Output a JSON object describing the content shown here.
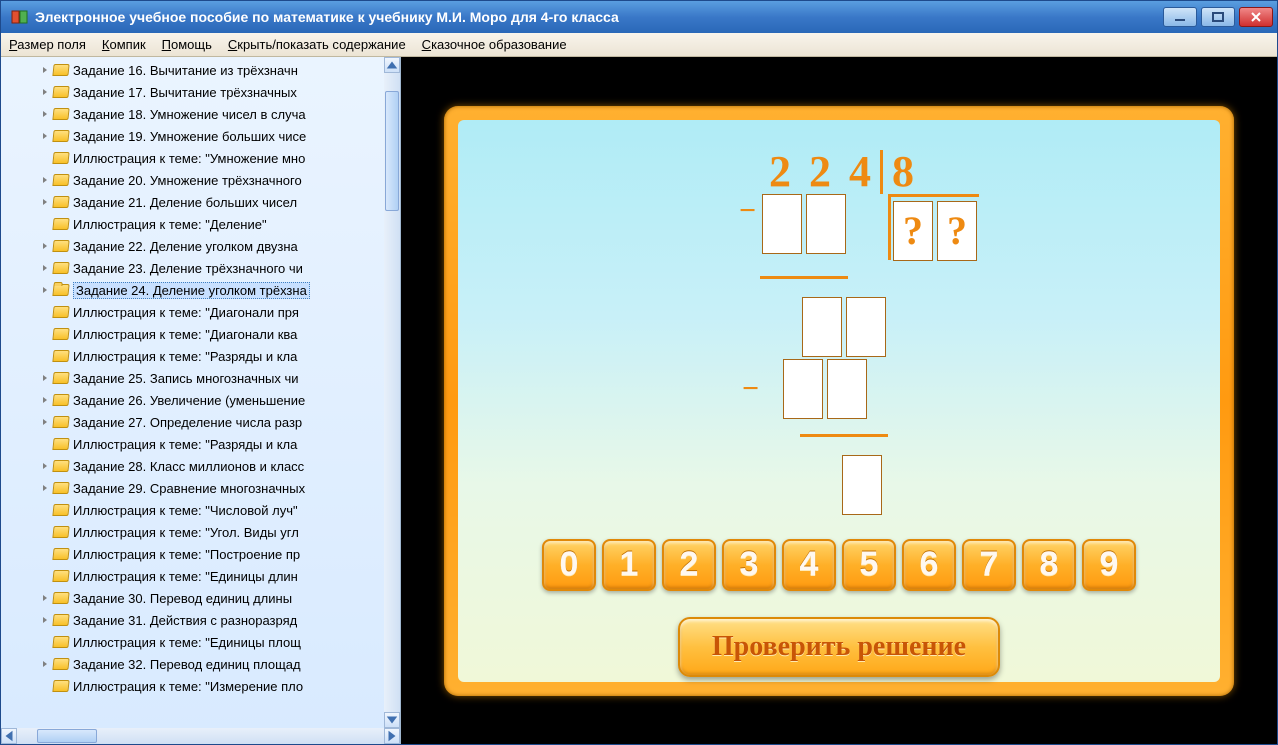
{
  "window": {
    "title": "Электронное учебное пособие по математике к учебнику М.И. Моро для 4-го класса"
  },
  "menu": {
    "items": [
      {
        "label": "Размер поля",
        "ul": "Р"
      },
      {
        "label": "Компик",
        "ul": "К"
      },
      {
        "label": "Помощь",
        "ul": "П"
      },
      {
        "label": "Скрыть/показать содержание",
        "ul": "С"
      },
      {
        "label": "Сказочное образование",
        "ul": "С"
      }
    ]
  },
  "tree": {
    "items": [
      {
        "label": "Задание 16. Вычитание из трёхзначн",
        "expandable": true
      },
      {
        "label": "Задание 17. Вычитание трёхзначных ",
        "expandable": true
      },
      {
        "label": "Задание 18. Умножение чисел в случа",
        "expandable": true
      },
      {
        "label": "Задание 19. Умножение больших чисе",
        "expandable": true
      },
      {
        "label": "Иллюстрация к теме: \"Умножение мно",
        "expandable": false
      },
      {
        "label": "Задание 20. Умножение трёхзначного",
        "expandable": true
      },
      {
        "label": "Задание 21. Деление больших чисел ",
        "expandable": true
      },
      {
        "label": "Иллюстрация к теме: \"Деление\"",
        "expandable": false
      },
      {
        "label": "Задание 22. Деление уголком двузна",
        "expandable": true
      },
      {
        "label": "Задание 23. Деление трёхзначного чи",
        "expandable": true
      },
      {
        "label": "Задание 24. Деление уголком трёхзна",
        "expandable": true,
        "selected": true,
        "open": true
      },
      {
        "label": "Иллюстрация к теме: \"Диагонали пря",
        "expandable": false
      },
      {
        "label": "Иллюстрация к теме: \"Диагонали ква",
        "expandable": false
      },
      {
        "label": "Иллюстрация к теме: \"Разряды и кла",
        "expandable": false
      },
      {
        "label": "Задание 25. Запись многозначных чи",
        "expandable": true
      },
      {
        "label": "Задание 26. Увеличение (уменьшение",
        "expandable": true
      },
      {
        "label": "Задание 27. Определение числа разр",
        "expandable": true
      },
      {
        "label": "Иллюстрация к теме: \"Разряды и кла",
        "expandable": false
      },
      {
        "label": "Задание 28. Класс миллионов и класс",
        "expandable": true
      },
      {
        "label": "Задание 29. Сравнение многозначных",
        "expandable": true
      },
      {
        "label": "Иллюстрация к теме: \"Числовой луч\"",
        "expandable": false
      },
      {
        "label": "Иллюстрация к теме: \"Угол. Виды угл",
        "expandable": false
      },
      {
        "label": "Иллюстрация к теме: \"Построение пр",
        "expandable": false
      },
      {
        "label": "Иллюстрация к теме: \"Единицы длин",
        "expandable": false
      },
      {
        "label": "Задание 30. Перевод единиц длины ",
        "expandable": true
      },
      {
        "label": "Задание 31. Действия с разноразряд",
        "expandable": true
      },
      {
        "label": "Иллюстрация к теме: \"Единицы площ",
        "expandable": false
      },
      {
        "label": "Задание 32. Перевод единиц площад",
        "expandable": true
      },
      {
        "label": "Иллюстрация к теме: \"Измерение пло",
        "expandable": false
      }
    ]
  },
  "problem": {
    "dividend": [
      "2",
      "2",
      "4"
    ],
    "divisor": "8",
    "quotient_placeholders": [
      "?",
      "?"
    ]
  },
  "numpad": [
    "0",
    "1",
    "2",
    "3",
    "4",
    "5",
    "6",
    "7",
    "8",
    "9"
  ],
  "buttons": {
    "check": "Проверить решение"
  }
}
